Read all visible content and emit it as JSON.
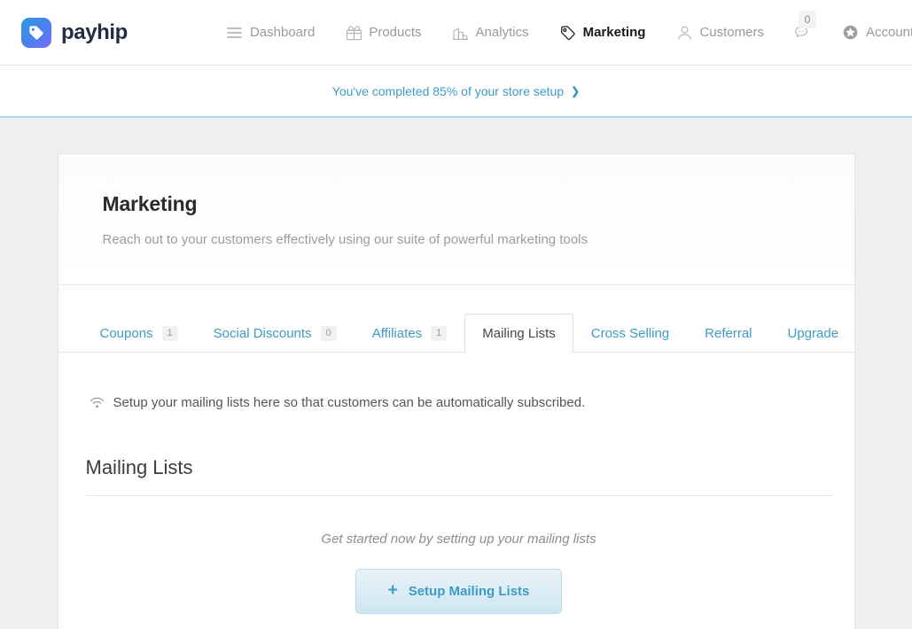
{
  "brand": {
    "name": "payhip",
    "logo_icon": "tag-heart-icon"
  },
  "nav": {
    "items": [
      {
        "label": "Dashboard",
        "icon": "hamburger-icon",
        "active": false
      },
      {
        "label": "Products",
        "icon": "gift-box-icon",
        "active": false
      },
      {
        "label": "Analytics",
        "icon": "bar-chart-icon",
        "active": false
      },
      {
        "label": "Marketing",
        "icon": "price-tag-icon",
        "active": true
      },
      {
        "label": "Customers",
        "icon": "person-icon",
        "active": false
      }
    ],
    "messages": {
      "icon": "chat-bubble-icon",
      "count": "0"
    },
    "account": {
      "label": "Account",
      "icon": "star-badge-icon",
      "chevron": "⌄"
    }
  },
  "setup_banner": {
    "text": "You've completed 85% of your store setup",
    "arrow": "❯",
    "accent_color": "#3d9bc4",
    "border_color": "#a9dcf2"
  },
  "card": {
    "title": "Marketing",
    "subtitle": "Reach out to your customers effectively using our suite of powerful marketing tools"
  },
  "tabs": [
    {
      "label": "Coupons",
      "badge": "1",
      "active": false
    },
    {
      "label": "Social Discounts",
      "badge": "0",
      "active": false
    },
    {
      "label": "Affiliates",
      "badge": "1",
      "active": false
    },
    {
      "label": "Mailing Lists",
      "badge": "",
      "active": true
    },
    {
      "label": "Cross Selling",
      "badge": "",
      "active": false
    },
    {
      "label": "Referral",
      "badge": "",
      "active": false
    },
    {
      "label": "Upgrade",
      "badge": "",
      "active": false
    }
  ],
  "panel": {
    "hint_icon": "wifi-broadcast-icon",
    "hint": "Setup your mailing lists here so that customers can be automatically subscribed.",
    "section_title": "Mailing Lists",
    "empty_text": "Get started now by setting up your mailing lists",
    "button_label": "Setup Mailing Lists",
    "button_icon": "plus-icon",
    "button_plus": "+"
  }
}
